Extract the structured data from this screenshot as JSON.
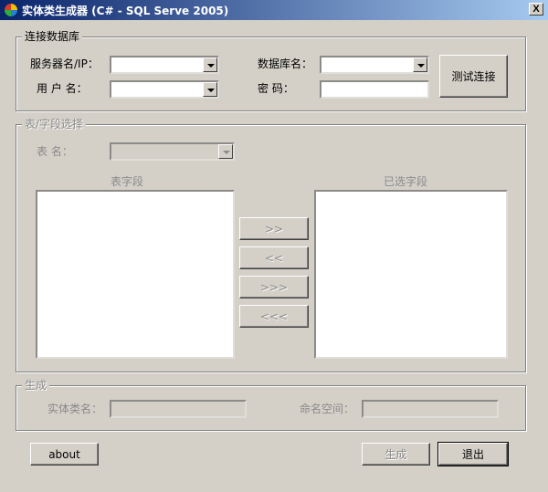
{
  "window": {
    "title": "实体类生成器 (C# - SQL Serve 2005)",
    "close_symbol": "X"
  },
  "connection": {
    "group_title": "连接数据库",
    "server_label": "服务器名/IP：",
    "server_value": "",
    "user_label": "用 户 名：",
    "user_value": "",
    "database_label": "数据库名：",
    "database_value": "",
    "password_label": "密   码：",
    "password_value": "",
    "test_button": "测试连接"
  },
  "table_fields": {
    "group_title": "表/字段选择",
    "table_label": "表    名：",
    "table_value": "",
    "fields_label": "表字段",
    "selected_label": "已选字段",
    "add_button": ">>",
    "remove_button": "<<",
    "add_all_button": ">>>",
    "remove_all_button": "<<<"
  },
  "generate": {
    "group_title": "生成",
    "class_label": "实体类名：",
    "class_value": "",
    "namespace_label": "命名空间：",
    "namespace_value": ""
  },
  "footer": {
    "about_button": "about",
    "generate_button": "生成",
    "exit_button": "退出"
  },
  "colors": {
    "face": "#d4d0c8",
    "titlebar_start": "#0a246a",
    "titlebar_end": "#a6caf0",
    "disabled_text": "#8a8a8a"
  }
}
